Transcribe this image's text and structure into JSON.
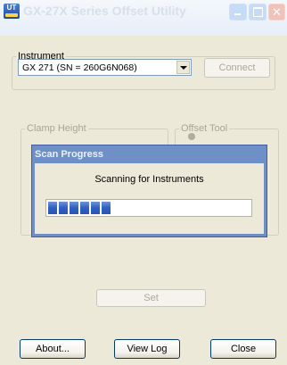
{
  "window": {
    "title": "GX-27X Series Offset Utility",
    "app_icon_text": "UT"
  },
  "instrument": {
    "group_label": "Instrument",
    "selected": "GX 271  (SN = 260G6N068)",
    "connect_label": "Connect",
    "connect_enabled": false
  },
  "clamp_height": {
    "group_label": "Clamp Height"
  },
  "offset_tool": {
    "group_label": "Offset Tool"
  },
  "set": {
    "label": "Set",
    "enabled": false
  },
  "footer": {
    "about_label": "About...",
    "view_log_label": "View Log",
    "close_label": "Close"
  },
  "scan_dialog": {
    "title": "Scan Progress",
    "message": "Scanning for Instruments",
    "progress": 0.36
  },
  "colors": {
    "window_bg": "#ece9d8",
    "progress_blue": "#2e5fc3",
    "dialog_frame": "#6e90c7"
  }
}
